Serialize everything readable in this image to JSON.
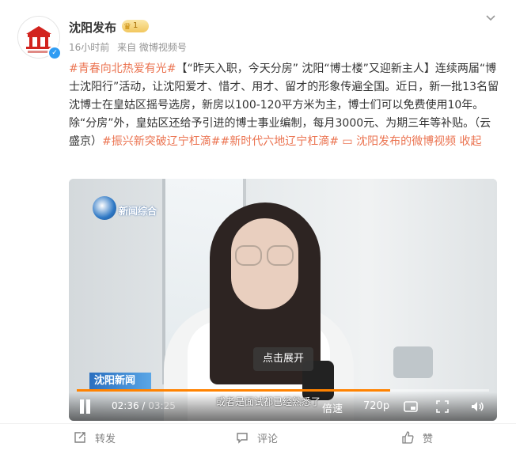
{
  "account": {
    "name": "沈阳发布",
    "badge_level": "1",
    "time_ago": "16小时前",
    "source": "来自 微博视频号"
  },
  "post": {
    "tag1": "#青春向北热爱有光#",
    "body1": "【“昨天入职，今天分房” 沈阳“博士楼”又迎新主人】连续两届“博士沈阳行”活动，让沈阳爱才、惜才、用才、留才的形象传遍全国。近日，新一批13名留沈博士在皇姑区摇号选房，新房以100-120平方米为主，博士们可以免费使用10年。除“分房”外，皇姑区还给予引进的博士事业编制，每月3000元、为期三年等补贴。（云盛京）",
    "tag2": "#振兴新突破辽宁杠滴#",
    "tag3": "#新时代六地辽宁杠滴#",
    "video_link": "沈阳发布的微博视频",
    "collapse": "收起"
  },
  "video": {
    "station_logo": "新闻综合",
    "lower_tag": "沈阳新闻",
    "expand_label": "点击展开",
    "subtitle": "或者是面试都已经熟悉了",
    "current_time": "02:36",
    "duration": "03:25",
    "progress": 0.76,
    "speed_label": "倍速",
    "quality_label": "720p"
  },
  "actions": {
    "repost": "转发",
    "comment": "评论",
    "like": "赞"
  },
  "colors": {
    "accent": "#eb7350",
    "progress": "#ff8200",
    "verified": "#2f9cf3"
  }
}
